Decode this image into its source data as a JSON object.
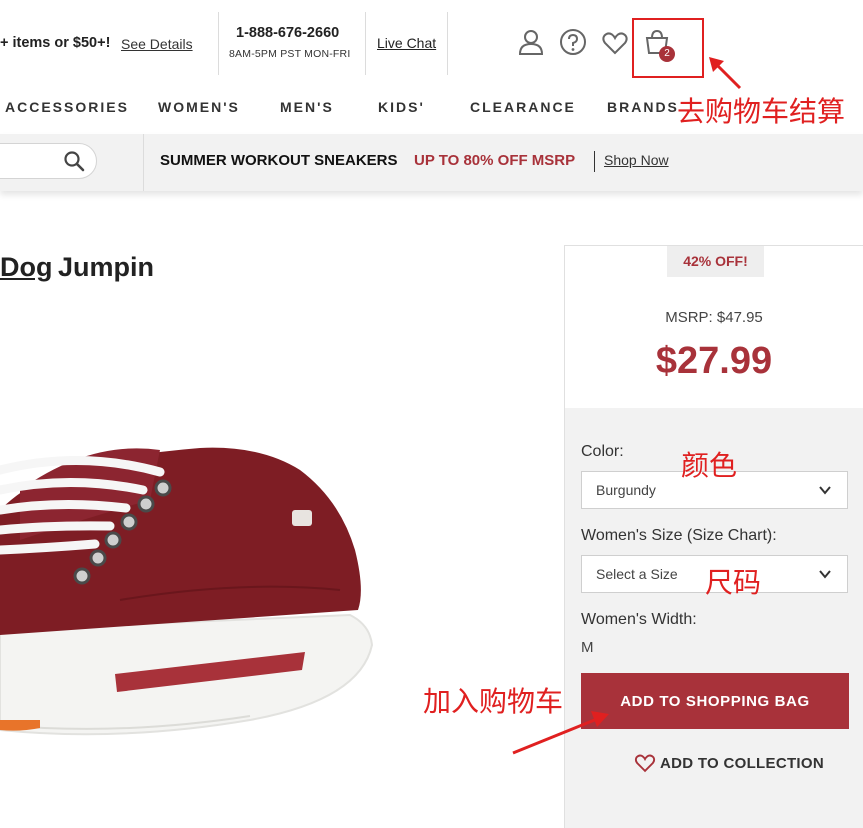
{
  "header": {
    "promo_text": "+ items or $50+!",
    "promo_link": "See Details",
    "phone": "1-888-676-2660",
    "hours": "8AM-5PM PST MON-FRI",
    "live_chat": "Live Chat",
    "cart_count": "2",
    "icons": [
      "account-icon",
      "help-icon",
      "heart-icon",
      "shopping-bag-icon"
    ]
  },
  "nav": {
    "items": [
      "ACCESSORIES",
      "WOMEN'S",
      "MEN'S",
      "KIDS'",
      "CLEARANCE",
      "BRANDS"
    ]
  },
  "banner": {
    "text_black": "SUMMER WORKOUT SNEAKERS",
    "text_red": "UP TO 80% OFF MSRP",
    "link": "Shop Now"
  },
  "product": {
    "title_brand": "Dog",
    "title_rest": "Jumpin",
    "discount_badge": "42% OFF!",
    "msrp": "MSRP: $47.95",
    "price": "$27.99",
    "color_label": "Color:",
    "color_value": "Burgundy",
    "size_label": "Women's Size (Size Chart):",
    "size_placeholder": "Select a Size",
    "width_label": "Women's Width:",
    "width_value": "M",
    "add_button": "ADD TO SHOPPING BAG",
    "collection_button": "ADD TO COLLECTION"
  },
  "annotations": {
    "cart": "去购物车结算",
    "color": "颜色",
    "size": "尺码",
    "add": "加入购物车"
  },
  "colors": {
    "accent": "#a8323a",
    "annotation": "#e02020",
    "panel": "#f2f2f2"
  }
}
